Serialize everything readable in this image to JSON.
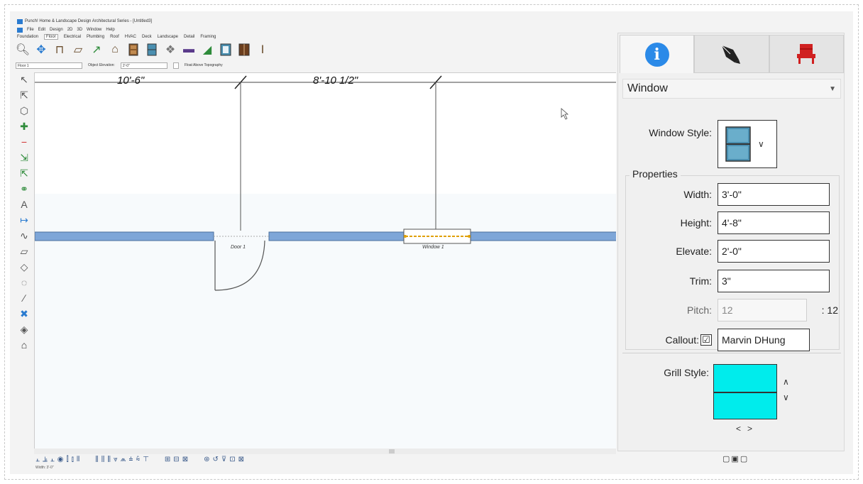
{
  "window": {
    "title": "Punch! Home & Landscape Design Architectural Series - [Untitled3]",
    "menus": [
      "File",
      "Edit",
      "Design",
      "2D",
      "3D",
      "Window",
      "Help"
    ]
  },
  "design_tabs": [
    "Foundation",
    "Floor",
    "Electrical",
    "Plumbing",
    "Roof",
    "HVAC",
    "Deck",
    "Landscape",
    "Detail",
    "Framing"
  ],
  "active_tab": "Floor",
  "options_bar": {
    "floor": "Floor 1",
    "elevation_label": "Object Elevation:",
    "elevation_value": "2'-0\"",
    "float_label": "Float Above Topography"
  },
  "canvas": {
    "dim_left": "10'-6\"",
    "dim_right": "8'-10 1/2\"",
    "door_label": "Door 1",
    "window_label": "Window 1"
  },
  "status": {
    "text": "Width: 3'-0\""
  },
  "panel": {
    "object_type": "Window",
    "window_style_label": "Window Style:",
    "properties_title": "Properties",
    "width_label": "Width:",
    "width_value": "3'-0\"",
    "height_label": "Height:",
    "height_value": "4'-8\"",
    "elevate_label": "Elevate:",
    "elevate_value": "2'-0\"",
    "trim_label": "Trim:",
    "trim_value": "3\"",
    "pitch_label": "Pitch:",
    "pitch_value": "12",
    "pitch_suffix": ": 12",
    "callout_label": "Callout:",
    "callout_checked": "☑",
    "callout_value": "Marvin DHung",
    "grill_style_label": "Grill Style:",
    "left_arrow": "<",
    "right_arrow": ">"
  },
  "colors": {
    "wall": "#7ea6d8",
    "grill": "#00ecec",
    "info_tab": "#2b8ae8",
    "window_style": "#4a8fb0"
  }
}
